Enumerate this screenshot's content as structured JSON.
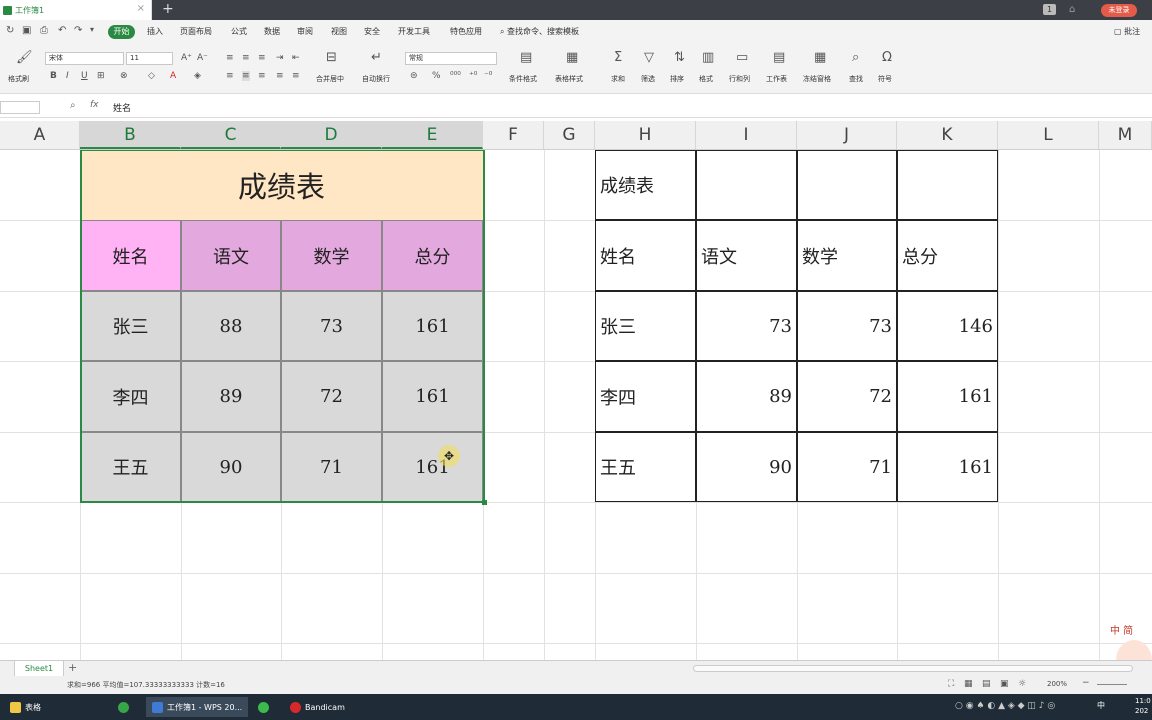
{
  "app": {
    "doc_tab": "工作簿1",
    "login": "未登录",
    "window_count": "1"
  },
  "menu": {
    "items": [
      "开始",
      "插入",
      "页面布局",
      "公式",
      "数据",
      "审阅",
      "视图",
      "安全",
      "开发工具",
      "特色应用"
    ],
    "search": "查找命令、搜索模板",
    "annotate": "批注"
  },
  "ribbon": {
    "format_painter": "格式刷",
    "font_name": "宋体",
    "font_size": "11",
    "merge_center": "合并居中",
    "wrap_text": "自动换行",
    "number_format": "常规",
    "conditional_format": "条件格式",
    "table_style": "表格样式",
    "sum": "求和",
    "filter": "筛选",
    "sort": "排序",
    "format": "格式",
    "rows_cols": "行和列",
    "worksheet": "工作表",
    "freeze": "冻结窗格",
    "find": "查找",
    "symbol": "符号"
  },
  "formula_bar": {
    "fx": "fx",
    "value": "姓名"
  },
  "columns": [
    "A",
    "B",
    "C",
    "D",
    "E",
    "F",
    "G",
    "H",
    "I",
    "J",
    "K",
    "L",
    "M"
  ],
  "left_table": {
    "title": "成绩表",
    "headers": [
      "姓名",
      "语文",
      "数学",
      "总分"
    ],
    "rows": [
      [
        "张三",
        "88",
        "73",
        "161"
      ],
      [
        "李四",
        "89",
        "72",
        "161"
      ],
      [
        "王五",
        "90",
        "71",
        "161"
      ]
    ],
    "colors": {
      "title_bg": "#ffe6c4",
      "name_header_bg": "#ffb3f5",
      "header_bg": "#e3a8de",
      "body_bg": "#d9d9d9",
      "border": "#2a8a43"
    }
  },
  "right_table": {
    "title": "成绩表",
    "headers": [
      "姓名",
      "语文",
      "数学",
      "总分"
    ],
    "rows": [
      [
        "张三",
        "73",
        "73",
        "146"
      ],
      [
        "李四",
        "89",
        "72",
        "161"
      ],
      [
        "王五",
        "90",
        "71",
        "161"
      ]
    ]
  },
  "sheets": {
    "active": "Sheet1",
    "add": "+"
  },
  "status": {
    "text": "求和=966  平均值=107.33333333333  计数=16",
    "zoom": "200%"
  },
  "taskbar": {
    "apps": [
      "表格",
      "工作簿1 - WPS 20...",
      "Bandicam"
    ],
    "ime": "中",
    "time": "11:0",
    "date": "202"
  },
  "watermark": "中 简"
}
